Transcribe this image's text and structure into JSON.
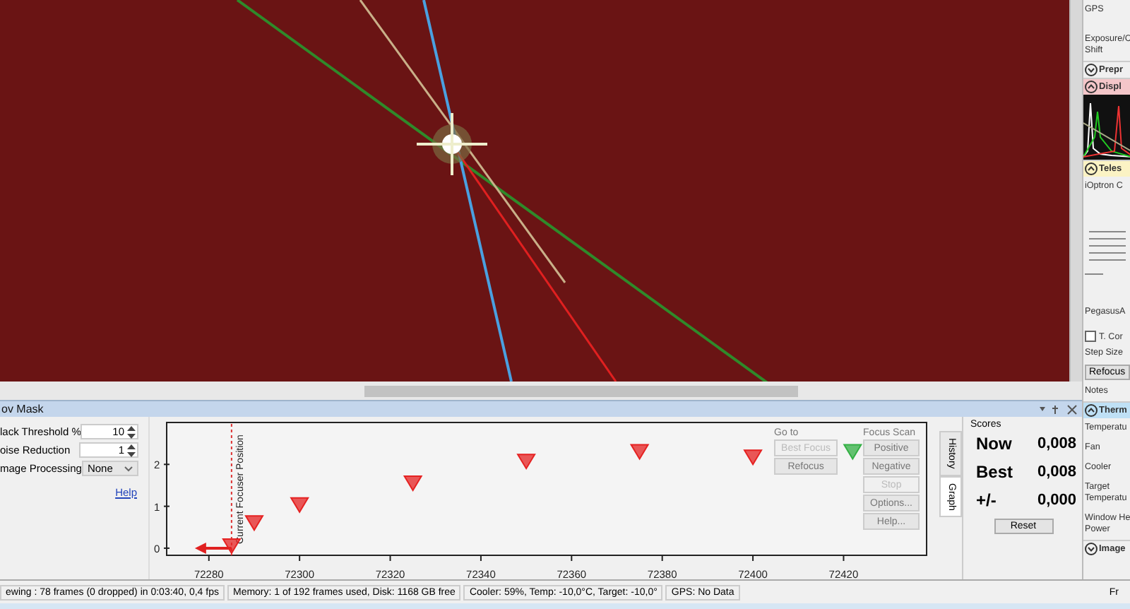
{
  "panel": {
    "title": "ov Mask",
    "settings": [
      {
        "kind": "spinner",
        "label": "lack Threshold %",
        "value": "10"
      },
      {
        "kind": "spinner",
        "label": "oise Reduction",
        "value": "1"
      },
      {
        "kind": "dropdown",
        "label": "mage Processing",
        "value": "None"
      }
    ],
    "help_link": "Help",
    "chart_data": {
      "type": "scatter",
      "xlim": [
        72271,
        72438
      ],
      "ylim": [
        -0.17,
        3
      ],
      "xticks": [
        72280,
        72300,
        72320,
        72340,
        72360,
        72380,
        72400,
        72420
      ],
      "yticks": [
        0,
        1,
        2
      ],
      "series": [
        {
          "color": "#e52222",
          "marker": "triangle",
          "x": [
            72285,
            72290,
            72300,
            72325,
            72350,
            72375,
            72400
          ],
          "values": [
            0.05,
            0.6,
            1.03,
            1.55,
            2.07,
            2.3,
            2.17
          ]
        },
        {
          "color": "#33b044",
          "marker": "triangle",
          "x": [
            72422
          ],
          "values": [
            2.3
          ]
        }
      ],
      "ref_lines": [
        {
          "axis": "x",
          "value": 72285,
          "label": "Current Focuser Position",
          "color": "#dd3333"
        }
      ]
    },
    "goto": {
      "title": "Go to",
      "dropdown": {
        "value": "Best Focus",
        "disabled": true
      },
      "buttons": [
        {
          "label": "Refocus",
          "disabled": false
        }
      ]
    },
    "focus_scan": {
      "title": "Focus Scan",
      "buttons": [
        {
          "label": "Positive",
          "disabled": false
        },
        {
          "label": "Negative",
          "disabled": false
        },
        {
          "label": "Stop",
          "disabled": true
        },
        {
          "label": "Options...",
          "disabled": false
        },
        {
          "label": "Help...",
          "disabled": false
        }
      ]
    },
    "side_tabs": [
      {
        "label": "History",
        "selected": false
      },
      {
        "label": "Graph",
        "selected": true
      }
    ],
    "scores": {
      "title": "Scores",
      "rows": [
        {
          "label": "Now",
          "value": "0,008"
        },
        {
          "label": "Best",
          "value": "0,008"
        },
        {
          "label": "+/-",
          "value": "0,000"
        }
      ],
      "reset": "Reset"
    }
  },
  "sidebar": {
    "items": [
      {
        "kind": "text",
        "lines": [
          "GPS"
        ]
      },
      {
        "kind": "text",
        "lines": [
          "Exposure/C",
          "Shift"
        ]
      },
      {
        "kind": "header",
        "label": "Prepr",
        "expanded": false,
        "color": "#f0f0f0"
      },
      {
        "kind": "header",
        "label": "Displ",
        "expanded": true,
        "color": "#f4c6c9"
      },
      {
        "kind": "histogram"
      },
      {
        "kind": "header",
        "label": "Teles",
        "expanded": true,
        "color": "#fbf3c4"
      },
      {
        "kind": "text",
        "lines": [
          "iOptron C"
        ]
      },
      {
        "kind": "readout"
      },
      {
        "kind": "text",
        "lines": [
          "PegasusA"
        ]
      },
      {
        "kind": "checkbox",
        "label": "T. Cor",
        "checked": false
      },
      {
        "kind": "text",
        "lines": [
          "Step Size"
        ]
      },
      {
        "kind": "button",
        "label": "Refocus"
      },
      {
        "kind": "text",
        "lines": [
          "Notes"
        ]
      },
      {
        "kind": "header",
        "label": "Therm",
        "expanded": true,
        "color": "#bfe0f5"
      },
      {
        "kind": "text",
        "lines": [
          "Temperatu"
        ]
      },
      {
        "kind": "text",
        "lines": [
          "Fan"
        ]
      },
      {
        "kind": "text",
        "lines": [
          "Cooler"
        ]
      },
      {
        "kind": "text",
        "lines": [
          "Target",
          "Temperatu"
        ]
      },
      {
        "kind": "text",
        "lines": [
          "Window He",
          "Power"
        ]
      },
      {
        "kind": "header",
        "label": "Image",
        "expanded": false,
        "color": "#f0f0f0"
      }
    ]
  },
  "status_bar": {
    "items": [
      "ewing : 78 frames (0 dropped) in 0:03:40, 0,4 fps",
      "Memory: 1 of 192 frames used, Disk: 1168 GB free",
      "Cooler: 59%, Temp: -10,0°C, Target: -10,0°",
      "GPS: No Data"
    ],
    "right": "Fr"
  }
}
